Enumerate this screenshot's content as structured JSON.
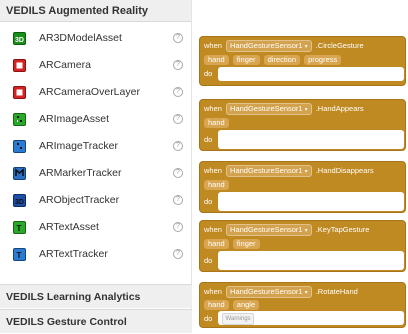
{
  "palette": {
    "header": "VEDILS Augmented Reality",
    "items": [
      {
        "label": "AR3DModelAsset",
        "icon": "3d-model-icon",
        "color": "#1a8f1a"
      },
      {
        "label": "ARCamera",
        "icon": "camera-icon",
        "color": "#d42424"
      },
      {
        "label": "ARCameraOverLayer",
        "icon": "camera-overlayer-icon",
        "color": "#d42424"
      },
      {
        "label": "ARImageAsset",
        "icon": "image-asset-icon",
        "color": "#2aa82a"
      },
      {
        "label": "ARImageTracker",
        "icon": "image-tracker-icon",
        "color": "#2a7bd4"
      },
      {
        "label": "ARMarkerTracker",
        "icon": "marker-tracker-icon",
        "color": "#2a6fc4"
      },
      {
        "label": "ARObjectTracker",
        "icon": "object-tracker-icon",
        "color": "#1f4ea8"
      },
      {
        "label": "ARTextAsset",
        "icon": "text-asset-icon",
        "color": "#2aa82a"
      },
      {
        "label": "ARTextTracker",
        "icon": "text-tracker-icon",
        "color": "#2a7bd4"
      }
    ],
    "help_glyph": "?",
    "footer_drawers": [
      "VEDILS Learning Analytics",
      "VEDILS Gesture Control"
    ]
  },
  "blocks": [
    {
      "when": "when",
      "sensor": "HandGestureSensor1",
      "event": ".CircleGesture",
      "params": [
        "hand",
        "finger",
        "direction",
        "progress"
      ],
      "do": "do"
    },
    {
      "when": "when",
      "sensor": "HandGestureSensor1",
      "event": ".HandAppears",
      "params": [
        "hand"
      ],
      "do": "do"
    },
    {
      "when": "when",
      "sensor": "HandGestureSensor1",
      "event": ".HandDisappears",
      "params": [
        "hand"
      ],
      "do": "do"
    },
    {
      "when": "when",
      "sensor": "HandGestureSensor1",
      "event": ".KeyTapGesture",
      "params": [
        "hand",
        "finger"
      ],
      "do": "do"
    },
    {
      "when": "when",
      "sensor": "HandGestureSensor1",
      "event": ".RotateHand",
      "params": [
        "hand",
        "angle"
      ],
      "do": "do",
      "warning": "Warnings"
    }
  ],
  "colors": {
    "event_block": "#c08a23",
    "param_chip": "#d8a550"
  }
}
